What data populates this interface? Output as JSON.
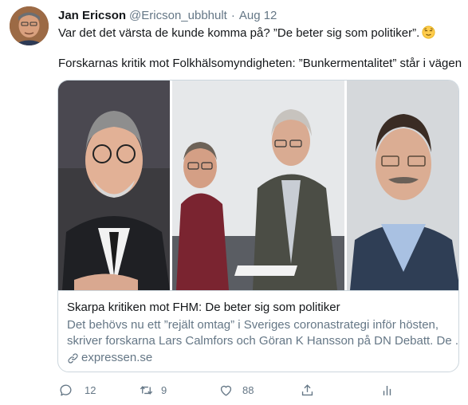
{
  "author": {
    "name": "Jan Ericson",
    "handle": "@Ericson_ubbhult",
    "separator": "·",
    "date": "Aug 12"
  },
  "tweet": {
    "line1": "Var det det värsta de kunde komma på? ”De beter sig som politiker”.",
    "line2": "Forskarnas kritik mot Folkhälsomyndigheten: ”Bunkermentalitet” står i vägen"
  },
  "card": {
    "title": "Skarpa kritiken mot FHM: De beter sig som politiker",
    "description_line1": "Det behövs nu ett ”rejält omtag” i Sveriges coronastrategi inför hösten,",
    "description_line2": "skriver forskarna Lars Calmfors och Göran K Hansson på DN Debatt. De ...",
    "domain": "expressen.se"
  },
  "actions": {
    "reply_count": "12",
    "retweet_count": "9",
    "like_count": "88"
  },
  "icons": {
    "reply": "reply-icon",
    "retweet": "retweet-icon",
    "like": "like-icon",
    "share": "share-icon",
    "analytics": "analytics-icon",
    "link": "link-icon",
    "emoji": "relieved-face-emoji"
  },
  "colors": {
    "text": "#14171a",
    "secondary": "#657786",
    "border": "#ccd6dd"
  }
}
